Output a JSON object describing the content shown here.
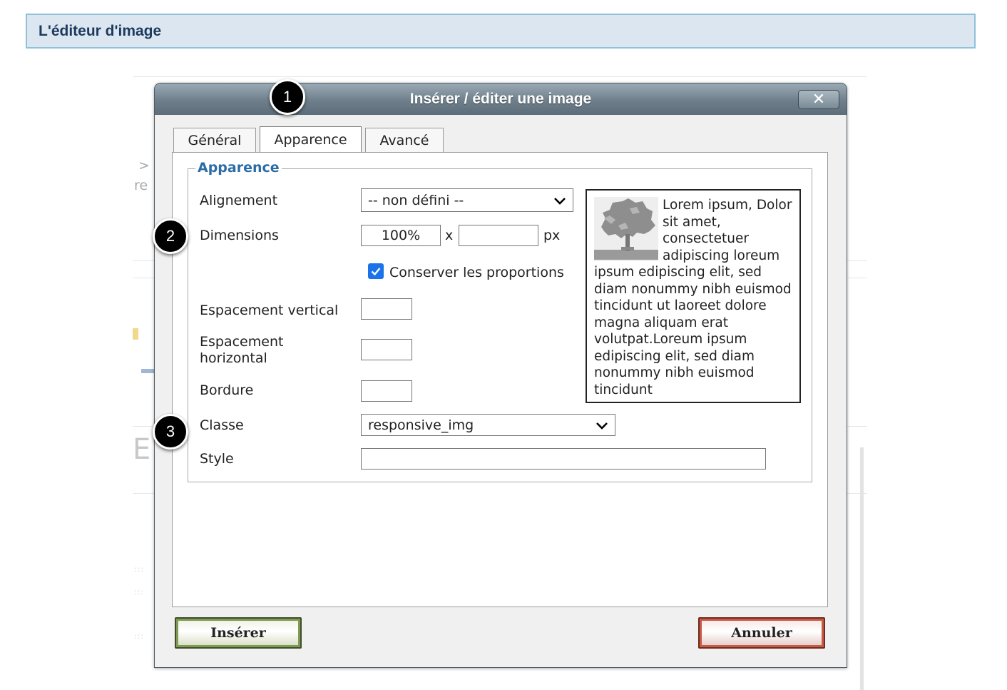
{
  "header": {
    "title": "L'éditeur d'image"
  },
  "background": {
    "text_a": ">",
    "text_b": "re",
    "text_c": "E"
  },
  "dialog": {
    "title": "Insérer / éditer une image",
    "close_icon": "close-icon",
    "tabs": [
      {
        "label": "Général",
        "active": false
      },
      {
        "label": "Apparence",
        "active": true
      },
      {
        "label": "Avancé",
        "active": false
      }
    ],
    "fieldset": {
      "legend": "Apparence",
      "alignment": {
        "label": "Alignement",
        "value": "-- non défini --"
      },
      "dimensions": {
        "label": "Dimensions",
        "width": "100%",
        "height": "",
        "separator": "x",
        "unit": "px"
      },
      "keep_ratio": {
        "label": "Conserver les proportions",
        "checked": true
      },
      "vspace": {
        "label": "Espacement vertical",
        "value": ""
      },
      "hspace": {
        "label_line1": "Espacement",
        "label_line2": "horizontal",
        "value": ""
      },
      "border": {
        "label": "Bordure",
        "value": ""
      },
      "class": {
        "label": "Classe",
        "value": "responsive_img"
      },
      "style": {
        "label": "Style",
        "value": ""
      },
      "preview_text": "Lorem ipsum, Dolor sit amet, consectetuer adipiscing loreum ipsum edipiscing elit, sed diam nonummy nibh euismod tincidunt ut laoreet dolore magna aliquam erat volutpat.Loreum ipsum edipiscing elit, sed diam nonummy nibh euismod tincidunt"
    },
    "buttons": {
      "insert": "Insérer",
      "cancel": "Annuler"
    }
  },
  "callouts": [
    "1",
    "2",
    "3"
  ],
  "colors": {
    "legend": "#2b6ca6",
    "checkbox": "#1a73e8",
    "titlebar": "#6e7f8b",
    "header_bg": "#dce6f1"
  }
}
